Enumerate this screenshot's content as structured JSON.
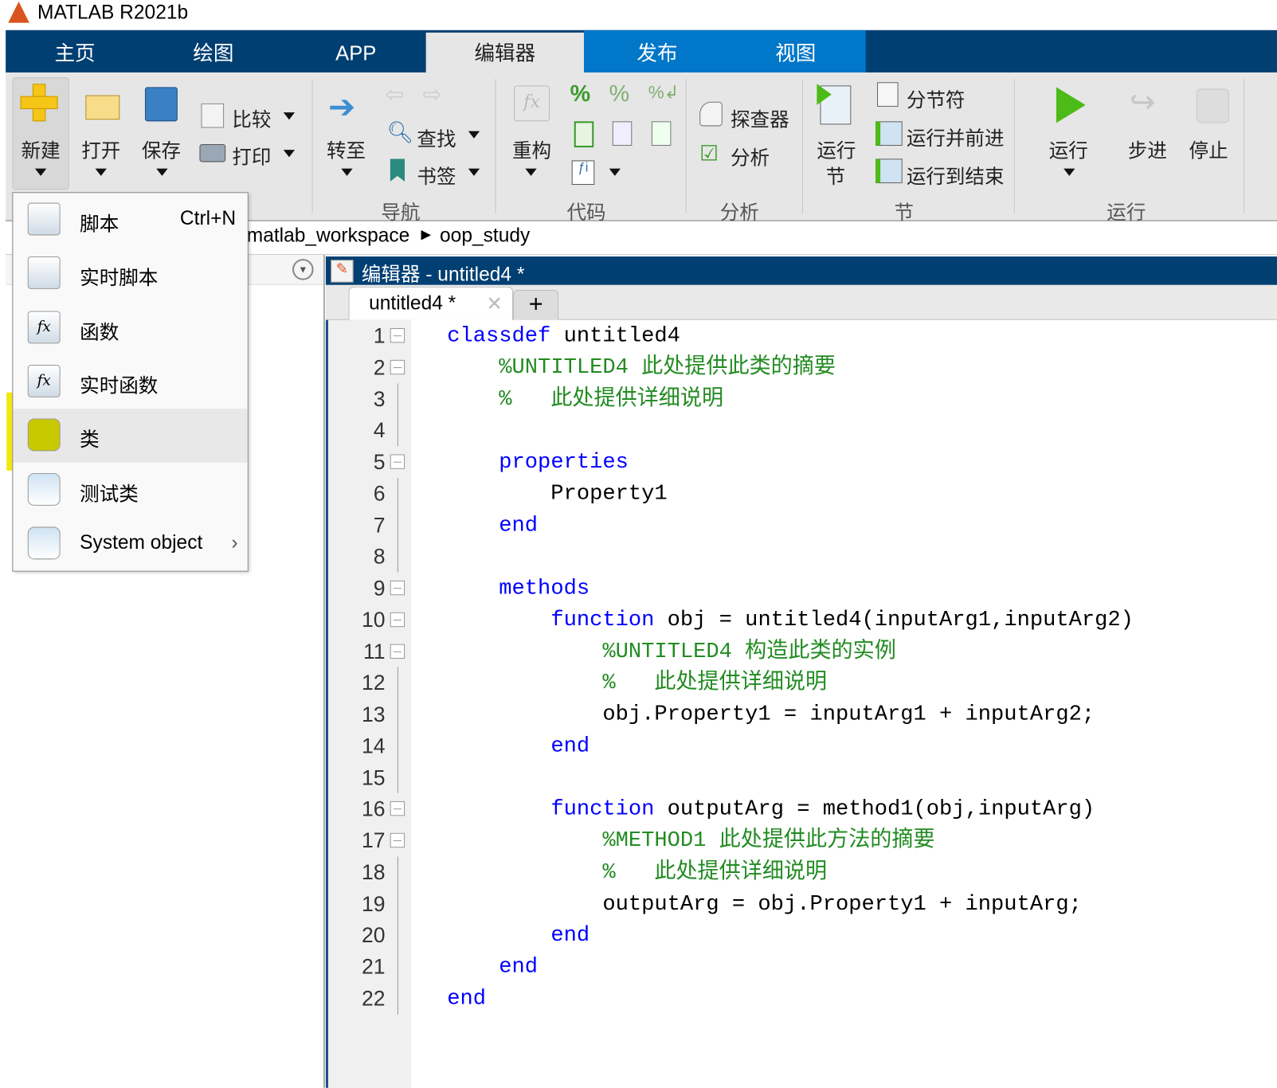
{
  "window": {
    "title": "MATLAB R2021b"
  },
  "tabs": [
    {
      "label": "主页"
    },
    {
      "label": "绘图"
    },
    {
      "label": "APP"
    },
    {
      "label": "编辑器",
      "selected": true
    },
    {
      "label": "发布"
    },
    {
      "label": "视图"
    }
  ],
  "ribbon": {
    "file": {
      "new": "新建",
      "open": "打开",
      "save": "保存",
      "compare": "比较",
      "print": "打印"
    },
    "nav": {
      "goto": "转至",
      "find": "查找",
      "bookmark": "书签",
      "group": "导航"
    },
    "code": {
      "refactor": "重构",
      "group": "代码"
    },
    "analyze": {
      "profiler": "探查器",
      "analyze": "分析",
      "group": "分析"
    },
    "section": {
      "run_section_1": "运行",
      "run_section_2": "节",
      "section_break": "分节符",
      "run_advance": "运行并前进",
      "run_to_end": "运行到结束",
      "group": "节"
    },
    "run": {
      "run": "运行",
      "step": "步进",
      "stop": "停止",
      "group": "运行"
    }
  },
  "address": {
    "path": [
      "matlab_workspace",
      "oop_study"
    ]
  },
  "new_menu": {
    "items": [
      {
        "label": "脚本",
        "shortcut": "Ctrl+N",
        "icon": "script-icon"
      },
      {
        "label": "实时脚本",
        "icon": "live-script-icon"
      },
      {
        "label": "函数",
        "icon": "function-icon"
      },
      {
        "label": "实时函数",
        "icon": "live-function-icon"
      },
      {
        "label": "类",
        "icon": "class-icon",
        "highlighted": true
      },
      {
        "label": "测试类",
        "icon": "test-class-icon"
      },
      {
        "label": "System object",
        "icon": "system-object-icon",
        "submenu": true
      }
    ]
  },
  "editor": {
    "title": "编辑器 - untitled4 *",
    "tab": "untitled4 *",
    "plus": "+",
    "lines": [
      {
        "n": "1",
        "fold": true,
        "seg": [
          [
            "kw",
            "classdef"
          ],
          [
            "tx",
            " untitled4"
          ]
        ]
      },
      {
        "n": "2",
        "fold": true,
        "seg": [
          [
            "tx",
            "    "
          ],
          [
            "cm",
            "%UNTITLED4 此处提供此类的摘要"
          ]
        ]
      },
      {
        "n": "3",
        "seg": [
          [
            "tx",
            "    "
          ],
          [
            "cm",
            "%   此处提供详细说明"
          ]
        ]
      },
      {
        "n": "4",
        "seg": []
      },
      {
        "n": "5",
        "fold": true,
        "seg": [
          [
            "tx",
            "    "
          ],
          [
            "kw",
            "properties"
          ]
        ]
      },
      {
        "n": "6",
        "seg": [
          [
            "tx",
            "        Property1"
          ]
        ]
      },
      {
        "n": "7",
        "seg": [
          [
            "tx",
            "    "
          ],
          [
            "kw",
            "end"
          ]
        ]
      },
      {
        "n": "8",
        "seg": []
      },
      {
        "n": "9",
        "fold": true,
        "seg": [
          [
            "tx",
            "    "
          ],
          [
            "kw",
            "methods"
          ]
        ]
      },
      {
        "n": "10",
        "fold": true,
        "seg": [
          [
            "tx",
            "        "
          ],
          [
            "kw",
            "function"
          ],
          [
            "tx",
            " obj = untitled4(inputArg1,inputArg2)"
          ]
        ]
      },
      {
        "n": "11",
        "fold": true,
        "seg": [
          [
            "tx",
            "            "
          ],
          [
            "cm",
            "%UNTITLED4 构造此类的实例"
          ]
        ]
      },
      {
        "n": "12",
        "seg": [
          [
            "tx",
            "            "
          ],
          [
            "cm",
            "%   此处提供详细说明"
          ]
        ]
      },
      {
        "n": "13",
        "seg": [
          [
            "tx",
            "            obj.Property1 = inputArg1 + inputArg2;"
          ]
        ]
      },
      {
        "n": "14",
        "seg": [
          [
            "tx",
            "        "
          ],
          [
            "kw",
            "end"
          ]
        ]
      },
      {
        "n": "15",
        "seg": []
      },
      {
        "n": "16",
        "fold": true,
        "seg": [
          [
            "tx",
            "        "
          ],
          [
            "kw",
            "function"
          ],
          [
            "tx",
            " outputArg = method1(obj,inputArg)"
          ]
        ]
      },
      {
        "n": "17",
        "fold": true,
        "seg": [
          [
            "tx",
            "            "
          ],
          [
            "cm",
            "%METHOD1 此处提供此方法的摘要"
          ]
        ]
      },
      {
        "n": "18",
        "seg": [
          [
            "tx",
            "            "
          ],
          [
            "cm",
            "%   此处提供详细说明"
          ]
        ]
      },
      {
        "n": "19",
        "seg": [
          [
            "tx",
            "            outputArg = obj.Property1 + inputArg;"
          ]
        ]
      },
      {
        "n": "20",
        "seg": [
          [
            "tx",
            "        "
          ],
          [
            "kw",
            "end"
          ]
        ]
      },
      {
        "n": "21",
        "seg": [
          [
            "tx",
            "    "
          ],
          [
            "kw",
            "end"
          ]
        ]
      },
      {
        "n": "22",
        "seg": [
          [
            "kw",
            "end"
          ]
        ]
      }
    ]
  },
  "colors": {
    "tab_navy": "#003f72",
    "tab_blue": "#0077c8",
    "keyword": "#0000ff",
    "comment": "#228b22",
    "highlight": "#f0e800"
  }
}
